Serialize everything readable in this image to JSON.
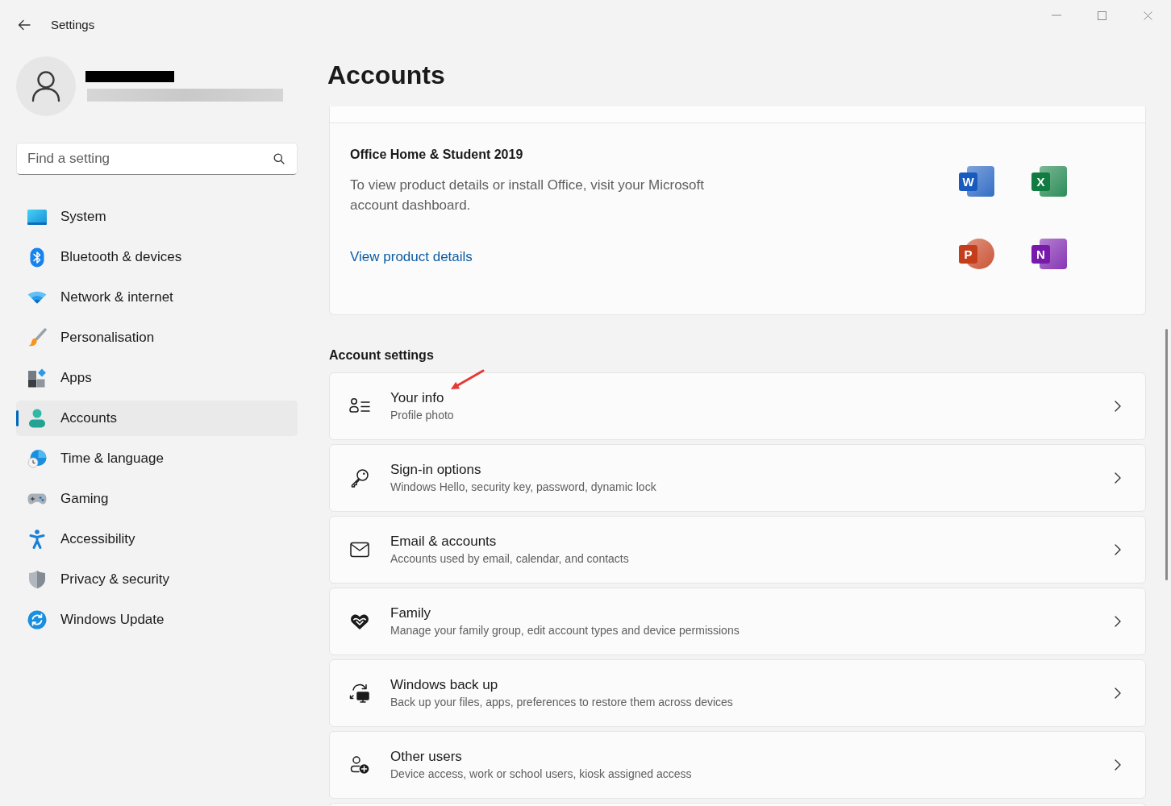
{
  "window": {
    "title": "Settings"
  },
  "search": {
    "placeholder": "Find a setting"
  },
  "sidebar": {
    "items": [
      {
        "label": "System",
        "selected": false
      },
      {
        "label": "Bluetooth & devices",
        "selected": false
      },
      {
        "label": "Network & internet",
        "selected": false
      },
      {
        "label": "Personalisation",
        "selected": false
      },
      {
        "label": "Apps",
        "selected": false
      },
      {
        "label": "Accounts",
        "selected": true
      },
      {
        "label": "Time & language",
        "selected": false
      },
      {
        "label": "Gaming",
        "selected": false
      },
      {
        "label": "Accessibility",
        "selected": false
      },
      {
        "label": "Privacy & security",
        "selected": false
      },
      {
        "label": "Windows Update",
        "selected": false
      }
    ]
  },
  "page": {
    "title": "Accounts"
  },
  "office": {
    "title": "Office Home & Student 2019",
    "description": "To view product details or install Office, visit your Microsoft account dashboard.",
    "link": "View product details",
    "apps": [
      {
        "letter": "W",
        "kind": "tile",
        "color": "#185abd"
      },
      {
        "letter": "X",
        "kind": "tile",
        "color": "#107c41"
      },
      {
        "letter": "P",
        "kind": "disc",
        "color": "#c43e1c"
      },
      {
        "letter": "N",
        "kind": "tile",
        "color": "#7719aa"
      }
    ]
  },
  "account_settings": {
    "heading": "Account settings",
    "rows": [
      {
        "title": "Your info",
        "subtitle": "Profile photo"
      },
      {
        "title": "Sign-in options",
        "subtitle": "Windows Hello, security key, password, dynamic lock"
      },
      {
        "title": "Email & accounts",
        "subtitle": "Accounts used by email, calendar, and contacts"
      },
      {
        "title": "Family",
        "subtitle": "Manage your family group, edit account types and device permissions"
      },
      {
        "title": "Windows back up",
        "subtitle": "Back up your files, apps, preferences to restore them across devices"
      },
      {
        "title": "Other users",
        "subtitle": "Device access, work or school users, kiosk assigned access"
      }
    ]
  }
}
